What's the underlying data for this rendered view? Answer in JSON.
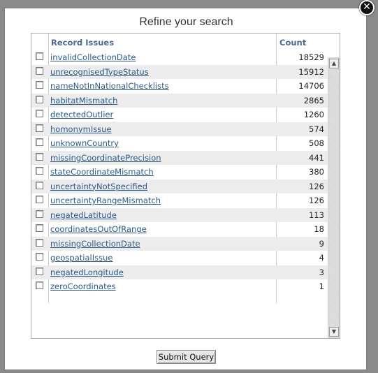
{
  "dialog": {
    "title": "Refine your search",
    "close_icon": "close-icon",
    "submit_label": "Submit Query"
  },
  "table": {
    "headers": {
      "issues": "Record Issues",
      "count": "Count"
    },
    "rows": [
      {
        "label": "invalidCollectionDate",
        "count": "18529",
        "checked": false
      },
      {
        "label": "unrecognisedTypeStatus",
        "count": "15912",
        "checked": false
      },
      {
        "label": "nameNotInNationalChecklists",
        "count": "14706",
        "checked": false
      },
      {
        "label": "habitatMismatch",
        "count": "2865",
        "checked": false
      },
      {
        "label": "detectedOutlier",
        "count": "1260",
        "checked": false
      },
      {
        "label": "homonymIssue",
        "count": "574",
        "checked": false
      },
      {
        "label": "unknownCountry",
        "count": "508",
        "checked": false
      },
      {
        "label": "missingCoordinatePrecision",
        "count": "441",
        "checked": false
      },
      {
        "label": "stateCoordinateMismatch",
        "count": "380",
        "checked": false
      },
      {
        "label": "uncertaintyNotSpecified",
        "count": "126",
        "checked": false
      },
      {
        "label": "uncertaintyRangeMismatch",
        "count": "126",
        "checked": false
      },
      {
        "label": "negatedLatitude",
        "count": "113",
        "checked": false
      },
      {
        "label": "coordinatesOutOfRange",
        "count": "18",
        "checked": false
      },
      {
        "label": "missingCollectionDate",
        "count": "9",
        "checked": false
      },
      {
        "label": "geospatialIssue",
        "count": "4",
        "checked": false
      },
      {
        "label": "negatedLongitude",
        "count": "3",
        "checked": false
      },
      {
        "label": "zeroCoordinates",
        "count": "1",
        "checked": false
      }
    ]
  },
  "colors": {
    "link": "#2a5a8a",
    "header": "#4a6a90",
    "alt_row": "#ececec",
    "backdrop": "#8a8a8a"
  }
}
